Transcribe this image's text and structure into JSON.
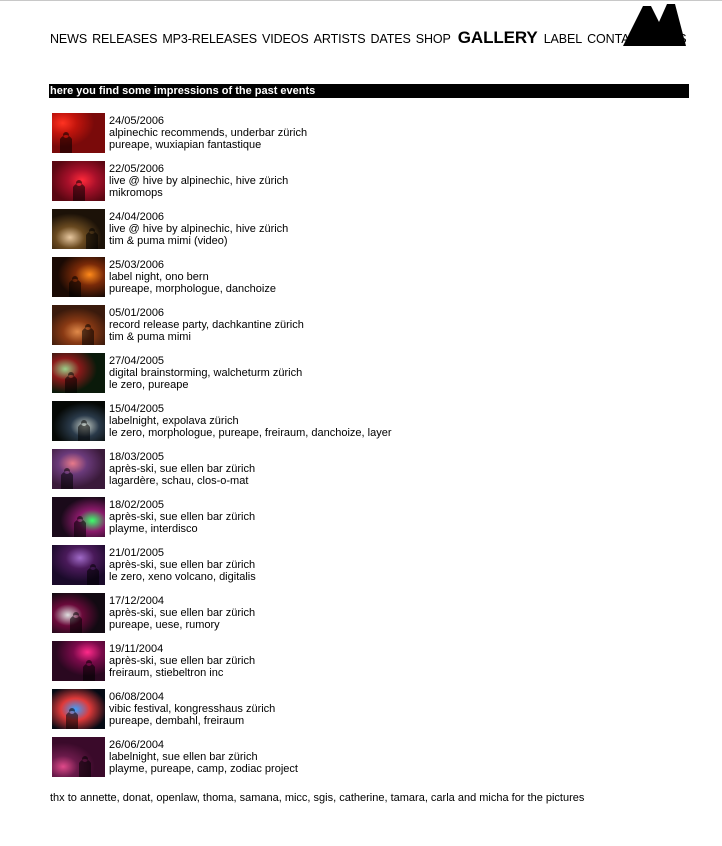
{
  "nav": {
    "items": [
      {
        "label": "NEWS",
        "active": false
      },
      {
        "label": "RELEASES",
        "active": false
      },
      {
        "label": "MP3-RELEASES",
        "active": false
      },
      {
        "label": "VIDEOS",
        "active": false
      },
      {
        "label": "ARTISTS",
        "active": false
      },
      {
        "label": "DATES",
        "active": false
      },
      {
        "label": "SHOP",
        "active": false
      },
      {
        "label": "GALLERY",
        "active": true
      },
      {
        "label": "LABEL",
        "active": false
      },
      {
        "label": "CONTACT",
        "active": false
      },
      {
        "label": "LINKS",
        "active": false
      }
    ]
  },
  "logo": {
    "name": "mountain-logo-icon",
    "color": "#000000"
  },
  "intro": "here you find some impressions of the past events",
  "events": [
    {
      "date": "24/05/2006",
      "title": "alpinechic recommends, underbar zürich",
      "artists": "pureape, wuxiapian fantastique",
      "thumb": {
        "bg": "#7a0a0a",
        "light": "#ff3322",
        "mid": "#c0140c"
      }
    },
    {
      "date": "22/05/2006",
      "title": "live @ hive by alpinechic, hive zürich",
      "artists": "mikromops",
      "thumb": {
        "bg": "#5a0712",
        "light": "#ff2a3a",
        "mid": "#a8102a"
      }
    },
    {
      "date": "24/04/2006",
      "title": "live @ hive by alpinechic, hive zürich",
      "artists": "tim & puma mimi (video)",
      "thumb": {
        "bg": "#1c1208",
        "light": "#e8c8a0",
        "mid": "#6a4a20"
      }
    },
    {
      "date": "25/03/2006",
      "title": "label night, ono bern",
      "artists": "pureape, morphologue, danchoize",
      "thumb": {
        "bg": "#1a0a04",
        "light": "#ff8a1a",
        "mid": "#7a2a08"
      }
    },
    {
      "date": "05/01/2006",
      "title": "record release party, dachkantine zürich",
      "artists": "tim & puma mimi",
      "thumb": {
        "bg": "#3a1a0c",
        "light": "#e08a4a",
        "mid": "#8a3a14"
      }
    },
    {
      "date": "27/04/2005",
      "title": "digital brainstorming, walcheturm zürich",
      "artists": "le zero, pureape",
      "thumb": {
        "bg": "#0a1a0a",
        "light": "#9ad08a",
        "mid": "#8a1a1a"
      }
    },
    {
      "date": "15/04/2005",
      "title": "labelnight, expolava zürich",
      "artists": "le zero, morphologue, pureape, freiraum, danchoize, layer",
      "thumb": {
        "bg": "#050805",
        "light": "#c8d0c8",
        "mid": "#2a3a4a"
      }
    },
    {
      "date": "18/03/2005",
      "title": "après-ski, sue ellen bar zürich",
      "artists": "lagardère, schau, clos-o-mat",
      "thumb": {
        "bg": "#3a1a3a",
        "light": "#e87a8a",
        "mid": "#6a3a7a"
      }
    },
    {
      "date": "18/02/2005",
      "title": "après-ski, sue ellen bar zürich",
      "artists": "playme, interdisco",
      "thumb": {
        "bg": "#1a0a1a",
        "light": "#3aff6a",
        "mid": "#8a1a6a"
      }
    },
    {
      "date": "21/01/2005",
      "title": "après-ski, sue ellen bar zürich",
      "artists": "le zero, xeno volcano, digitalis",
      "thumb": {
        "bg": "#1a0a2a",
        "light": "#a06ac8",
        "mid": "#4a1a5a"
      }
    },
    {
      "date": "17/12/2004",
      "title": "après-ski, sue ellen bar zürich",
      "artists": "pureape, uese, rumory",
      "thumb": {
        "bg": "#120a12",
        "light": "#e0e0e0",
        "mid": "#6a0a3a"
      }
    },
    {
      "date": "19/11/2004",
      "title": "après-ski, sue ellen bar zürich",
      "artists": "freiraum, stiebeltron inc",
      "thumb": {
        "bg": "#2a0820",
        "light": "#ff2a8a",
        "mid": "#7a0a4a"
      }
    },
    {
      "date": "06/08/2004",
      "title": "vibic festival, kongresshaus zürich",
      "artists": "pureape, dembahl, freiraum",
      "thumb": {
        "bg": "#050a14",
        "light": "#3aa0ff",
        "mid": "#e03a3a"
      }
    },
    {
      "date": "26/06/2004",
      "title": "labelnight, sue ellen bar zürich",
      "artists": "playme, pureape, camp, zodiac project",
      "thumb": {
        "bg": "#3a0a2a",
        "light": "#e04a8a",
        "mid": "#6a1a4a"
      }
    }
  ],
  "footer": "thx to annette, donat, openlaw, thoma, samana, micc, sgis, catherine, tamara, carla and micha for the pictures"
}
